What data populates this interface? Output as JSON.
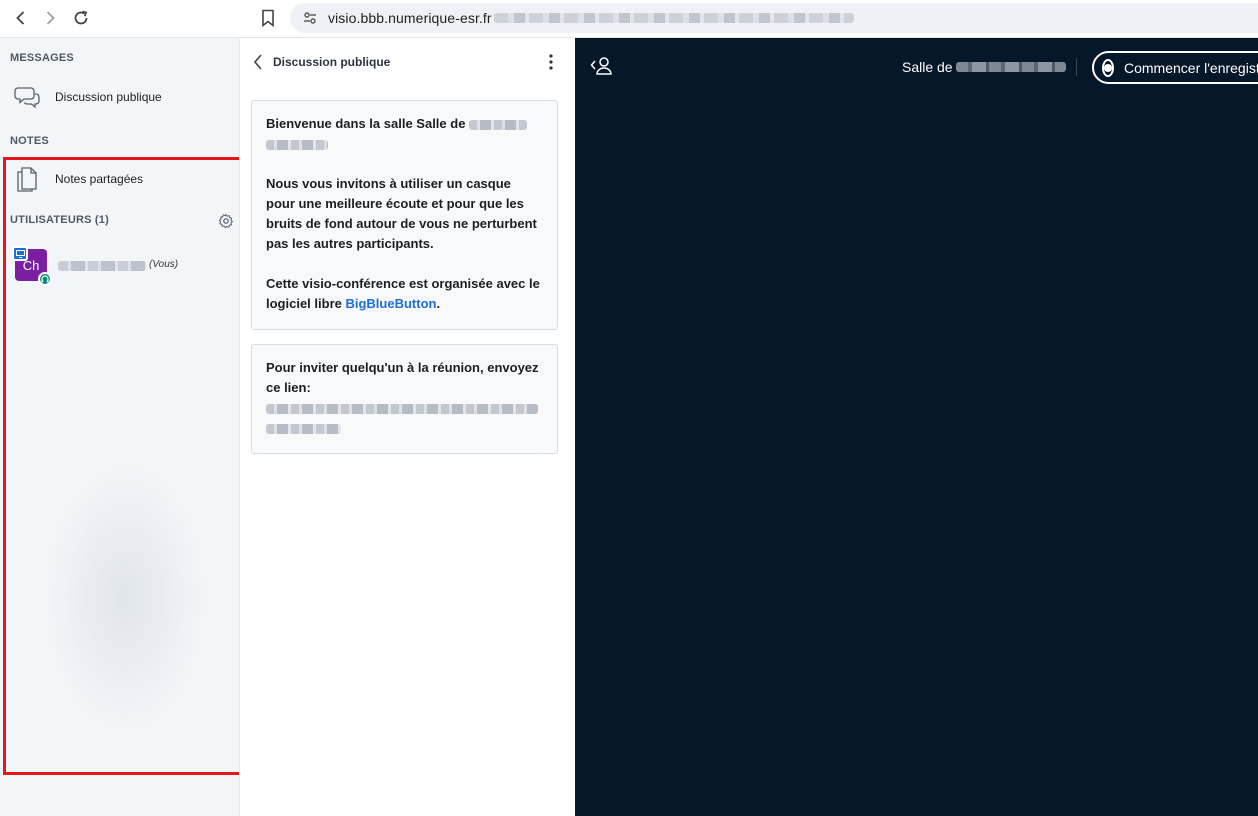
{
  "browser": {
    "url_host": "visio.bbb.numerique-esr.fr",
    "url_path": "/bbb-32/b/redacted-path"
  },
  "sidebar": {
    "messages_title": "MESSAGES",
    "public_chat_label": "Discussion publique",
    "notes_title": "NOTES",
    "shared_notes_label": "Notes partagées",
    "users_title": "UTILISATEURS (1)",
    "current_user": {
      "initials": "Ch",
      "you_label": "(Vous)"
    }
  },
  "chat": {
    "title": "Discussion publique",
    "welcome": {
      "intro": "Bienvenue dans la salle ",
      "intro_bold": "Salle de",
      "headset": "Nous vous invitons à utiliser un casque pour une meilleure écoute et pour que les bruits de fond autour de vous ne perturbent pas les autres participants.",
      "software_prefix": "Cette visio-conférence est organisée avec le logiciel libre ",
      "software_link": "BigBlueButton",
      "software_suffix": "."
    },
    "invite": {
      "text": "Pour inviter quelqu'un à la réunion, envoyez ce lien:"
    }
  },
  "main": {
    "room_title_prefix": "Salle de",
    "record_label": "Commencer l'enregistrement"
  },
  "colors": {
    "highlight_box": "#e6161d",
    "avatar": "#7b1fa2",
    "presentation_bg": "#06172a",
    "link": "#1e6ed8"
  }
}
